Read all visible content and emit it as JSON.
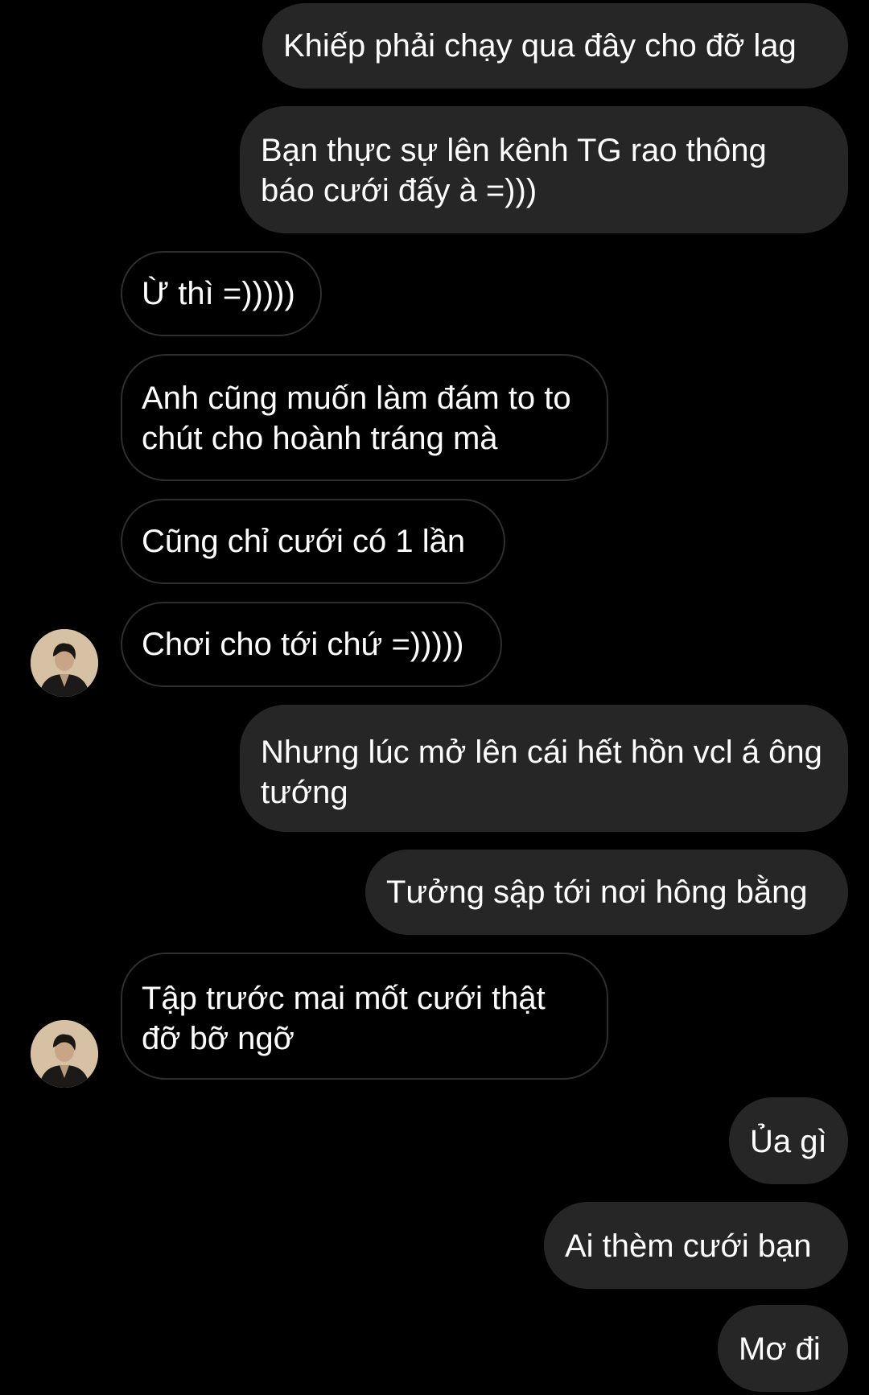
{
  "conversation": {
    "messages": [
      {
        "side": "sent",
        "text": "Khiếp phải chạy qua đây cho đỡ lag"
      },
      {
        "side": "sent",
        "text": "Bạn thực sự lên kênh TG rao thông báo cưới đấy à =)))"
      },
      {
        "side": "received",
        "text": "Ừ thì =)))))"
      },
      {
        "side": "received",
        "text": "Anh cũng muốn làm đám to to chút cho hoành tráng mà"
      },
      {
        "side": "received",
        "text": "Cũng chỉ cưới có 1 lần"
      },
      {
        "side": "received",
        "text": "Chơi cho tới chứ =)))))"
      },
      {
        "side": "sent",
        "text": "Nhưng lúc mở lên cái hết hồn vcl á ông tướng"
      },
      {
        "side": "sent",
        "text": "Tưởng sập tới nơi hông bằng"
      },
      {
        "side": "received",
        "text": "Tập trước mai mốt cưới thật đỡ bỡ ngỡ"
      },
      {
        "side": "sent",
        "text": "Ủa gì"
      },
      {
        "side": "sent",
        "text": "Ai thèm cưới bạn"
      },
      {
        "side": "sent",
        "text": "Mơ đi"
      }
    ]
  },
  "colors": {
    "background": "#000000",
    "sent_bubble": "#262626",
    "received_border": "#2e2e2e",
    "text": "#ffffff"
  },
  "icons": {
    "avatar": "contact-avatar-photo"
  }
}
